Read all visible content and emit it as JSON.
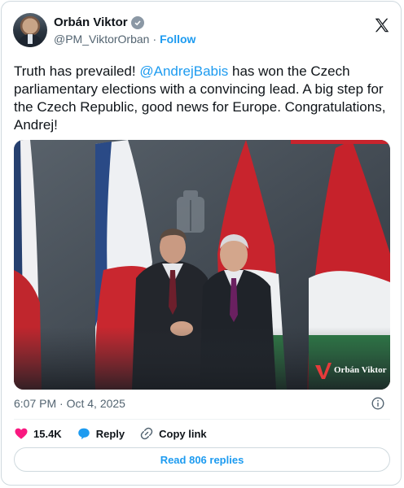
{
  "author": {
    "name": "Orbán Viktor",
    "handle": "@PM_ViktorOrban",
    "separator": "·",
    "follow_label": "Follow",
    "verified_icon": "verified-badge-icon"
  },
  "post": {
    "text_before": "Truth has prevailed! ",
    "mention": "@AndrejBabis",
    "text_after": " has won the Czech parliamentary elections with a convincing lead. A big step for the Czech Republic, good news for Europe. Congratulations, Andrej!",
    "photo_watermark": "Orbán Viktor",
    "timestamp": "6:07 PM · Oct 4, 2025"
  },
  "actions": {
    "likes": "15.4K",
    "reply_label": "Reply",
    "copy_label": "Copy link"
  },
  "read_replies_label": "Read 806 replies",
  "colors": {
    "accent": "#1d9bf0",
    "like": "#f91880",
    "muted": "#536471"
  }
}
